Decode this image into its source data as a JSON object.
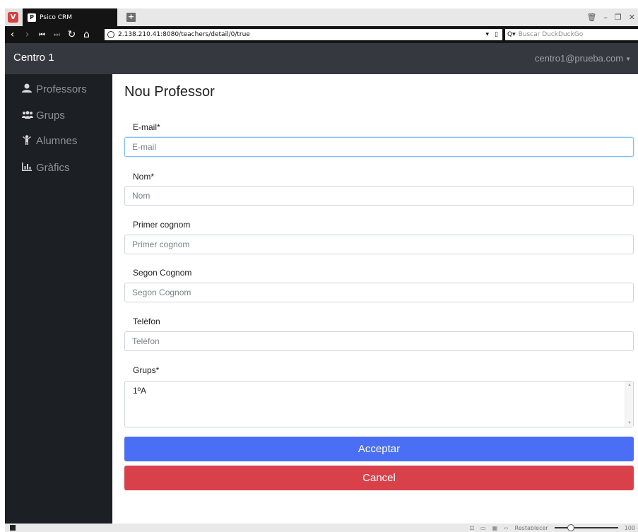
{
  "browser": {
    "tab_title": "Psico CRM",
    "url": "2.138.210.41:8080/teachers/detail/0/true",
    "search_placeholder": "Buscar DuckDuckGo",
    "status_reset_label": "Restablecer",
    "zoom_value": "100"
  },
  "app": {
    "brand": "Centro 1",
    "user_email": "centro1@prueba.com"
  },
  "sidebar": {
    "items": [
      {
        "label": "Professors",
        "icon": "user-icon"
      },
      {
        "label": "Grups",
        "icon": "users-icon"
      },
      {
        "label": "Alumnes",
        "icon": "child-icon"
      },
      {
        "label": "Gràfics",
        "icon": "bar-chart-icon"
      }
    ]
  },
  "form": {
    "title": "Nou Professor",
    "email": {
      "label": "E-mail*",
      "placeholder": "E-mail",
      "value": ""
    },
    "nom": {
      "label": "Nom*",
      "placeholder": "Nom",
      "value": ""
    },
    "primer_cognom": {
      "label": "Primer cognom",
      "placeholder": "Primer cognom",
      "value": ""
    },
    "segon_cognom": {
      "label": "Segon Cognom",
      "placeholder": "Segon Cognom",
      "value": ""
    },
    "telefon": {
      "label": "Telèfon",
      "placeholder": "Telèfon",
      "value": ""
    },
    "grups": {
      "label": "Grups*",
      "options": [
        "1ºA"
      ]
    },
    "accept_label": "Acceptar",
    "cancel_label": "Cancel"
  },
  "colors": {
    "primary": "#4a6ff5",
    "danger": "#d9414a",
    "topbar": "#35393f",
    "sidebar": "#1c1f23"
  }
}
